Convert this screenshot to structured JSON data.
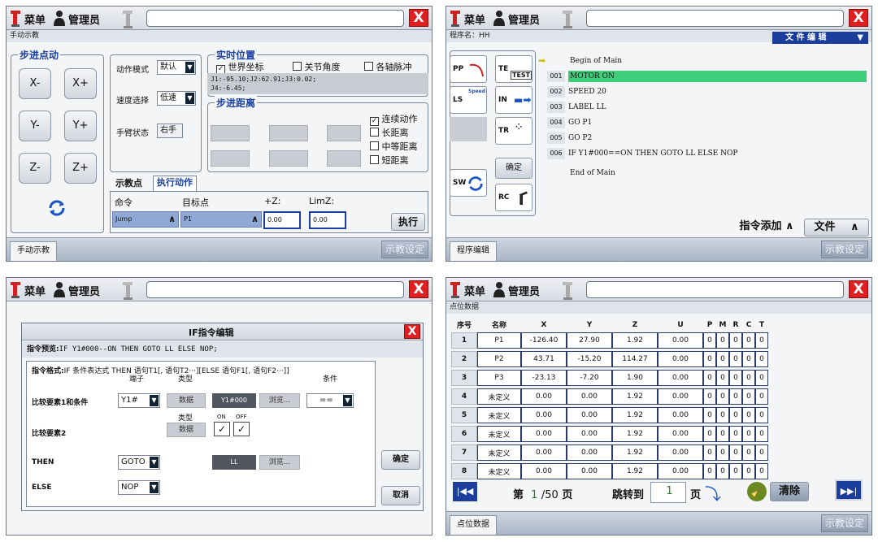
{
  "common": {
    "menu": "菜单",
    "admin": "管理员",
    "close": "X",
    "teach_set": "示教设定"
  },
  "p1": {
    "subtitle": "手动示教",
    "step_title": "步进点动",
    "jog": [
      "X-",
      "X+",
      "Y-",
      "Y+",
      "Z-",
      "Z+"
    ],
    "mode_label": "动作模式",
    "mode_value": "默认",
    "speed_label": "速度选择",
    "speed_value": "低速",
    "hand_label": "手臂状态",
    "hand_value": "右手",
    "pos_title": "实时位置",
    "world": "世界坐标",
    "joint": "关节角度",
    "pulse": "各轴脉冲",
    "pos_line1": "J1:-95.10;J2:62.91;J3:0.02;",
    "pos_line2": "J4:-6.45;",
    "dist_title": "步进距离",
    "cont": "连续动作",
    "long": "长距离",
    "mid": "中等距离",
    "short": "短距离",
    "tab1": "示教点",
    "tab2": "执行动作",
    "cmd_label": "命令",
    "target_label": "目标点",
    "z_label": "+Z:",
    "limz_label": "LimZ:",
    "cmd_value": "Jump",
    "target_value": "P1",
    "z_value": "0.00",
    "limz_value": "0.00",
    "exec": "执行",
    "bottom_tab": "手动示教"
  },
  "p2": {
    "subtitle": "程序名：HH",
    "file_edit": "文 件 编 辑",
    "begin": "Begin of Main",
    "end": "End of Main",
    "lines": [
      {
        "n": "001",
        "t": "MOTOR ON"
      },
      {
        "n": "002",
        "t": "SPEED 20"
      },
      {
        "n": "003",
        "t": "LABEL LL"
      },
      {
        "n": "004",
        "t": "GO P1"
      },
      {
        "n": "005",
        "t": "GO P2"
      },
      {
        "n": "006",
        "t": "IF Y1#000==ON THEN GOTO LL ELSE NOP"
      }
    ],
    "icons": {
      "pp": "PP",
      "te": "TE",
      "test": "TEST",
      "ls": "LS",
      "speed": "Speed",
      "in": "IN",
      "tr": "TR",
      "sw": "SW",
      "rc": "RC"
    },
    "confirm": "确定",
    "add_cmd": "指令添加",
    "file": "文件",
    "bottom_tab": "程序编辑"
  },
  "p3": {
    "title": "IF指令编辑",
    "preview_label": "指令预览:",
    "preview": "IF Y1#000--ON THEN GOTO LL ELSE NOP;",
    "format_label": "指令格式:",
    "format": "IF 条件表达式 THEN 语句T1[, 语句T2···][ELSE 语句F1[, 语句F2···]]",
    "port_label": "端子",
    "type_label": "类型",
    "cond_label": "条件",
    "cmp1": "比较要素1和条件",
    "port_value": "Y1#",
    "type1": "数据",
    "port_code": "Y1#000",
    "browse": "浏览...",
    "cond_value": "==",
    "type2_label": "类型",
    "on": "ON",
    "off": "OFF",
    "cmp2": "比较要素2",
    "type2": "数据",
    "then": "THEN",
    "then_value": "GOTO",
    "ll": "LL",
    "else": "ELSE",
    "else_value": "NOP",
    "ok": "确定",
    "cancel": "取消"
  },
  "p4": {
    "subtitle": "点位数据",
    "headers": [
      "序号",
      "名称",
      "X",
      "Y",
      "Z",
      "U",
      "P",
      "M",
      "R",
      "C",
      "T"
    ],
    "rows": [
      [
        "1",
        "P1",
        "-126.40",
        "27.90",
        "1.92",
        "0.00",
        "0",
        "0",
        "0",
        "0",
        "0"
      ],
      [
        "2",
        "P2",
        "43.71",
        "-15.20",
        "114.27",
        "0.00",
        "0",
        "0",
        "0",
        "0",
        "0"
      ],
      [
        "3",
        "P3",
        "-23.13",
        "-7.20",
        "1.90",
        "0.00",
        "0",
        "0",
        "0",
        "0",
        "0"
      ],
      [
        "4",
        "未定义",
        "0.00",
        "0.00",
        "1.92",
        "0.00",
        "0",
        "0",
        "0",
        "0",
        "0"
      ],
      [
        "5",
        "未定义",
        "0.00",
        "0.00",
        "1.92",
        "0.00",
        "0",
        "0",
        "0",
        "0",
        "0"
      ],
      [
        "6",
        "未定义",
        "0.00",
        "0.00",
        "1.92",
        "0.00",
        "0",
        "0",
        "0",
        "0",
        "0"
      ],
      [
        "7",
        "未定义",
        "0.00",
        "0.00",
        "1.92",
        "0.00",
        "0",
        "0",
        "0",
        "0",
        "0"
      ],
      [
        "8",
        "未定义",
        "0.00",
        "0.00",
        "1.92",
        "0.00",
        "0",
        "0",
        "0",
        "0",
        "0"
      ]
    ],
    "page_prefix": "第",
    "page_current": "1",
    "page_total": "/50",
    "page_suffix": "页",
    "jump_label": "跳转到",
    "jump_value": "1",
    "jump_suffix": "页",
    "clear": "清除",
    "bottom_tab": "点位数据"
  }
}
